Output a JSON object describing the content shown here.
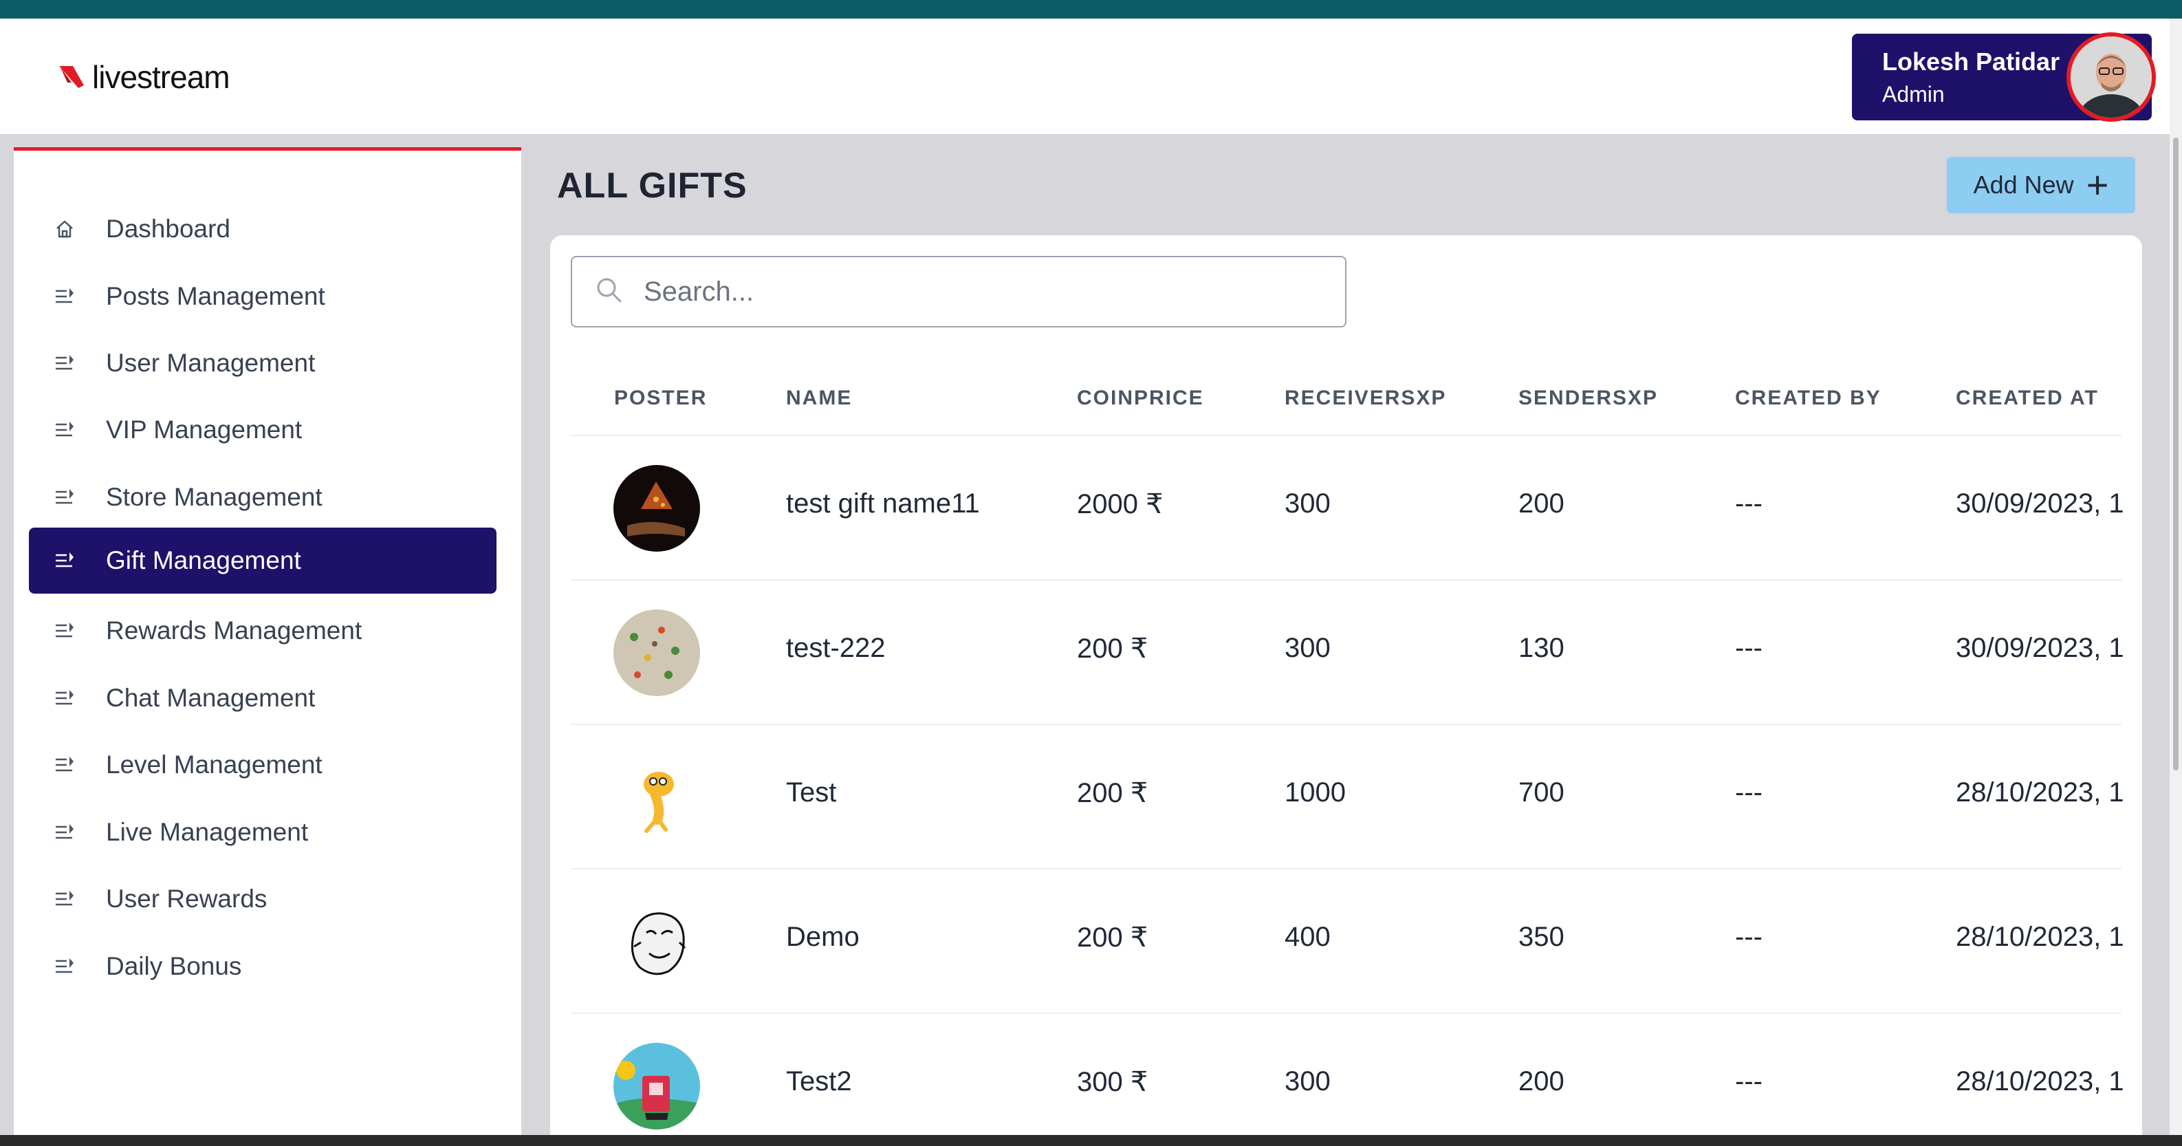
{
  "header": {
    "logo_text": "livestream",
    "user_name": "Lokesh Patidar",
    "user_role": "Admin"
  },
  "sidebar": {
    "items": [
      {
        "label": "Dashboard",
        "icon": "home-icon"
      },
      {
        "label": "Posts Management",
        "icon": "list-arrow-icon"
      },
      {
        "label": "User Management",
        "icon": "list-arrow-icon"
      },
      {
        "label": "VIP Management",
        "icon": "list-arrow-icon"
      },
      {
        "label": "Store Management",
        "icon": "list-arrow-icon"
      },
      {
        "label": "Gift Management",
        "icon": "list-arrow-icon",
        "active": true
      },
      {
        "label": "Rewards Management",
        "icon": "list-arrow-icon"
      },
      {
        "label": "Chat Management",
        "icon": "list-arrow-icon"
      },
      {
        "label": "Level Management",
        "icon": "list-arrow-icon"
      },
      {
        "label": "Live Management",
        "icon": "list-arrow-icon"
      },
      {
        "label": "User Rewards",
        "icon": "list-arrow-icon"
      },
      {
        "label": "Daily Bonus",
        "icon": "list-arrow-icon"
      }
    ]
  },
  "main": {
    "title": "ALL GIFTS",
    "add_button_label": "Add New",
    "search_placeholder": "Search..."
  },
  "table": {
    "columns": [
      "POSTER",
      "NAME",
      "COINPRICE",
      "RECEIVERSXP",
      "SENDERSXP",
      "CREATED BY",
      "CREATED AT"
    ],
    "rows": [
      {
        "name": "test gift name11",
        "coinprice": "2000 ₹",
        "receiversxp": "300",
        "sendersxp": "200",
        "created_by": "---",
        "created_at": "30/09/2023, 1"
      },
      {
        "name": "test-222",
        "coinprice": "200 ₹",
        "receiversxp": "300",
        "sendersxp": "130",
        "created_by": "---",
        "created_at": "30/09/2023, 1"
      },
      {
        "name": "Test",
        "coinprice": "200 ₹",
        "receiversxp": "1000",
        "sendersxp": "700",
        "created_by": "---",
        "created_at": "28/10/2023, 1"
      },
      {
        "name": "Demo",
        "coinprice": "200 ₹",
        "receiversxp": "400",
        "sendersxp": "350",
        "created_by": "---",
        "created_at": "28/10/2023, 1"
      },
      {
        "name": "Test2",
        "coinprice": "300 ₹",
        "receiversxp": "300",
        "sendersxp": "200",
        "created_by": "---",
        "created_at": "28/10/2023, 1"
      }
    ]
  },
  "colors": {
    "accent": "#1e1169",
    "brand_red": "#e31b23",
    "add_button": "#8ecdf2",
    "top_strip": "#0a5d66"
  }
}
